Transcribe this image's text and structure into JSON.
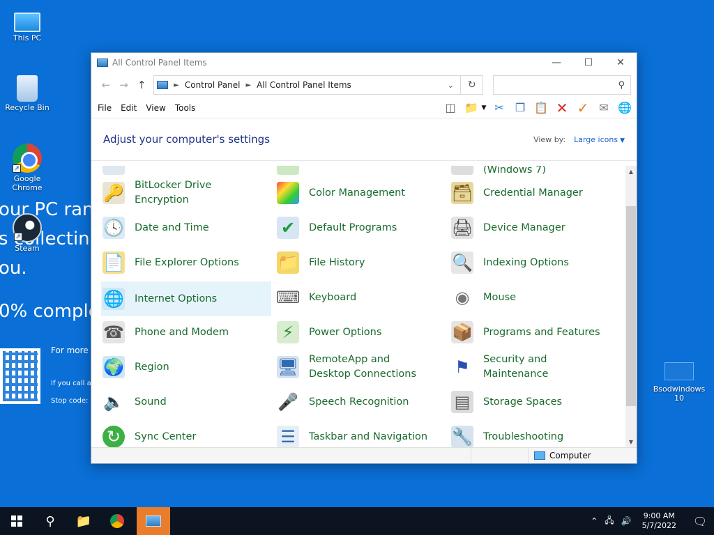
{
  "desktop": {
    "bsod_lines": [
      "our PC ran",
      "s collectin",
      "ou.",
      "0% comple"
    ],
    "bsod_more": "For more",
    "bsod_call": "If you call a",
    "bsod_stop": "Stop code: c",
    "icons": [
      {
        "label": "This PC"
      },
      {
        "label": "Recycle Bin"
      },
      {
        "label": "Google Chrome"
      },
      {
        "label": "Steam"
      }
    ],
    "right_icon": {
      "label": "Bsodwindows 10"
    }
  },
  "window": {
    "title": "All Control Panel Items",
    "breadcrumb": [
      "Control Panel",
      "All Control Panel Items"
    ],
    "search_placeholder": "",
    "menu": [
      "File",
      "Edit",
      "View",
      "Tools"
    ],
    "heading": "Adjust your computer's settings",
    "view_by_label": "View by:",
    "view_by_value": "Large icons",
    "partial_top": "(Windows 7)",
    "items": [
      {
        "label": "BitLocker Drive Encryption",
        "icon": "bitlocker-icon"
      },
      {
        "label": "Color Management",
        "icon": "color-management-icon"
      },
      {
        "label": "Credential Manager",
        "icon": "credential-manager-icon"
      },
      {
        "label": "Date and Time",
        "icon": "date-time-icon"
      },
      {
        "label": "Default Programs",
        "icon": "default-programs-icon"
      },
      {
        "label": "Device Manager",
        "icon": "device-manager-icon"
      },
      {
        "label": "File Explorer Options",
        "icon": "folder-options-icon"
      },
      {
        "label": "File History",
        "icon": "file-history-icon"
      },
      {
        "label": "Indexing Options",
        "icon": "indexing-icon"
      },
      {
        "label": "Internet Options",
        "icon": "internet-options-icon"
      },
      {
        "label": "Keyboard",
        "icon": "keyboard-icon"
      },
      {
        "label": "Mouse",
        "icon": "mouse-icon"
      },
      {
        "label": "Phone and Modem",
        "icon": "phone-icon"
      },
      {
        "label": "Power Options",
        "icon": "power-icon"
      },
      {
        "label": "Programs and Features",
        "icon": "programs-icon"
      },
      {
        "label": "Region",
        "icon": "region-icon"
      },
      {
        "label": "RemoteApp and Desktop Connections",
        "icon": "remoteapp-icon"
      },
      {
        "label": "Security and Maintenance",
        "icon": "security-flag-icon"
      },
      {
        "label": "Sound",
        "icon": "speaker-icon"
      },
      {
        "label": "Speech Recognition",
        "icon": "microphone-icon"
      },
      {
        "label": "Storage Spaces",
        "icon": "storage-icon"
      },
      {
        "label": "Sync Center",
        "icon": "sync-icon"
      },
      {
        "label": "Taskbar and Navigation",
        "icon": "taskbar-icon"
      },
      {
        "label": "Troubleshooting",
        "icon": "troubleshooting-icon"
      }
    ],
    "status": "Computer"
  },
  "taskbar": {
    "time": "9:00 AM",
    "date": "5/7/2022"
  }
}
